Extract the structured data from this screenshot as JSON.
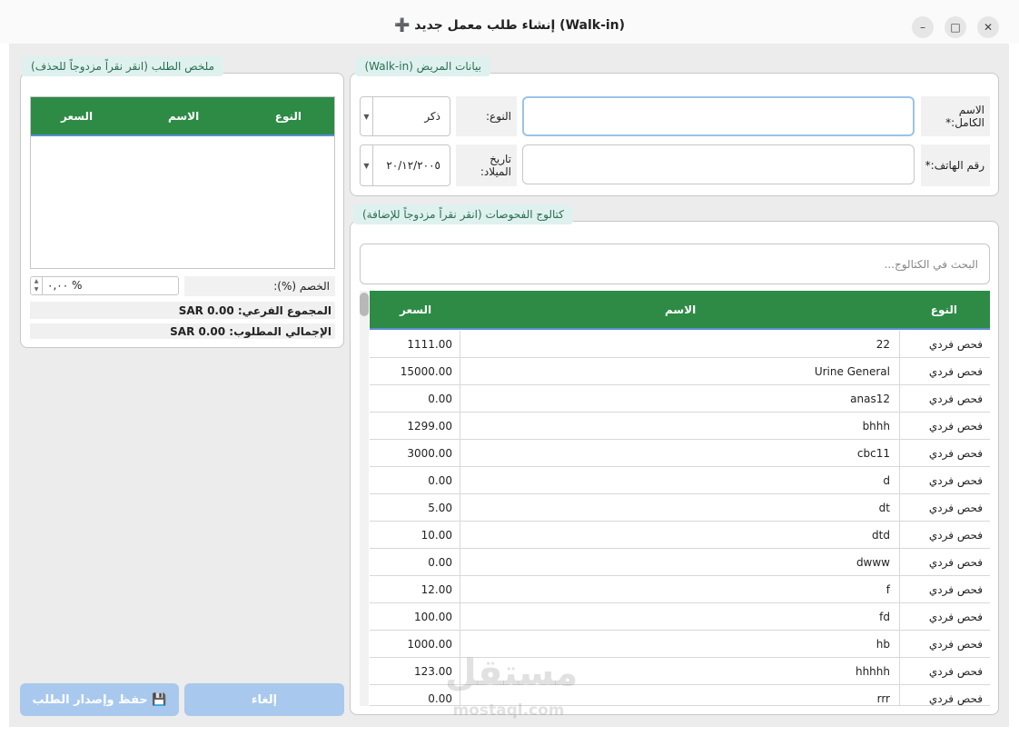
{
  "window": {
    "title": "➕ إنشاء طلب معمل جديد (Walk-in)",
    "minimize": "–",
    "maximize": "□",
    "close": "✕"
  },
  "patient": {
    "group_title": "بيانات المريض (Walk-in)",
    "full_name_label": "الاسم الكامل:*",
    "full_name_value": "",
    "gender_label": "النوع:",
    "gender_value": "ذكر",
    "phone_label": "رقم الهاتف:*",
    "phone_value": "",
    "dob_label": "تاريخ الميلاد:",
    "dob_value": "٢٠/١٢/٢٠٠٥"
  },
  "catalog": {
    "group_title": "كتالوج الفحوصات (انقر نقراً مزدوجاً للإضافة)",
    "search_placeholder": "البحث في الكتالوج...",
    "columns": {
      "type": "النوع",
      "name": "الاسم",
      "price": "السعر"
    },
    "rows": [
      {
        "type": "فحص فردي",
        "name": "22",
        "price": "1111.00"
      },
      {
        "type": "فحص فردي",
        "name": "Urine General",
        "price": "15000.00"
      },
      {
        "type": "فحص فردي",
        "name": "anas12",
        "price": "0.00"
      },
      {
        "type": "فحص فردي",
        "name": "bhhh",
        "price": "1299.00"
      },
      {
        "type": "فحص فردي",
        "name": "cbc11",
        "price": "3000.00"
      },
      {
        "type": "فحص فردي",
        "name": "d",
        "price": "0.00"
      },
      {
        "type": "فحص فردي",
        "name": "dt",
        "price": "5.00"
      },
      {
        "type": "فحص فردي",
        "name": "dtd",
        "price": "10.00"
      },
      {
        "type": "فحص فردي",
        "name": "dwww",
        "price": "0.00"
      },
      {
        "type": "فحص فردي",
        "name": "f",
        "price": "12.00"
      },
      {
        "type": "فحص فردي",
        "name": "fd",
        "price": "100.00"
      },
      {
        "type": "فحص فردي",
        "name": "hb",
        "price": "1000.00"
      },
      {
        "type": "فحص فردي",
        "name": "hhhhh",
        "price": "123.00"
      },
      {
        "type": "فحص فردي",
        "name": "rrr",
        "price": "0.00"
      }
    ]
  },
  "summary": {
    "group_title": "ملخص الطلب (انقر نقراً مزدوجاً للحذف)",
    "columns": {
      "type": "النوع",
      "name": "الاسم",
      "price": "السعر"
    },
    "discount_label": "الخصم (%):",
    "discount_value": "٠,٠٠ %",
    "subtotal": "المجموع الفرعي: SAR 0.00",
    "total": "الإجمالي المطلوب: SAR 0.00"
  },
  "actions": {
    "cancel_label": "إلغاء",
    "save_label": "💾 حفظ وإصدار الطلب"
  },
  "watermark": {
    "main": "مستقل",
    "sub": "mostaql.com"
  },
  "colors": {
    "header_green": "#2e8b46",
    "button_blue": "#a9c8ee",
    "group_title_bg": "#dff1ee"
  }
}
